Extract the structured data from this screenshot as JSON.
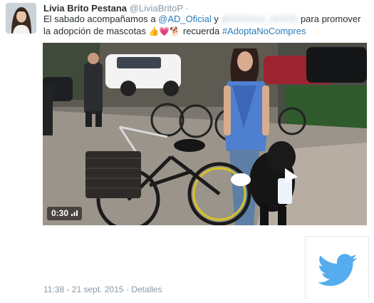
{
  "tweet": {
    "display_name": "Livia Brito Pestana",
    "handle": "@LiviaBritoP",
    "separator": "·",
    "text_intro": "El sabado acompañamos a ",
    "mention_1": "@AD_Oficial",
    "text_and": " y ",
    "mention_2_redacted": "@DOGGA_HOOD",
    "text_middle": " para promover la adopción de mascotas ",
    "emojis": "👍💗🐕",
    "text_before_hashtag": " recuerda ",
    "hashtag": "#AdoptaNoCompres"
  },
  "video": {
    "duration": "0:30",
    "progress": 0
  },
  "footer": {
    "timestamp": "11:38 - 21 sept. 2015",
    "details_link": "Detalles"
  },
  "icons": {
    "brand": "twitter-bird-icon",
    "duration": "signal-bars-icon"
  },
  "colors": {
    "link": "#2b7bb9",
    "muted": "#8899a6",
    "text": "#292f33",
    "twitter_blue": "#55acee"
  }
}
